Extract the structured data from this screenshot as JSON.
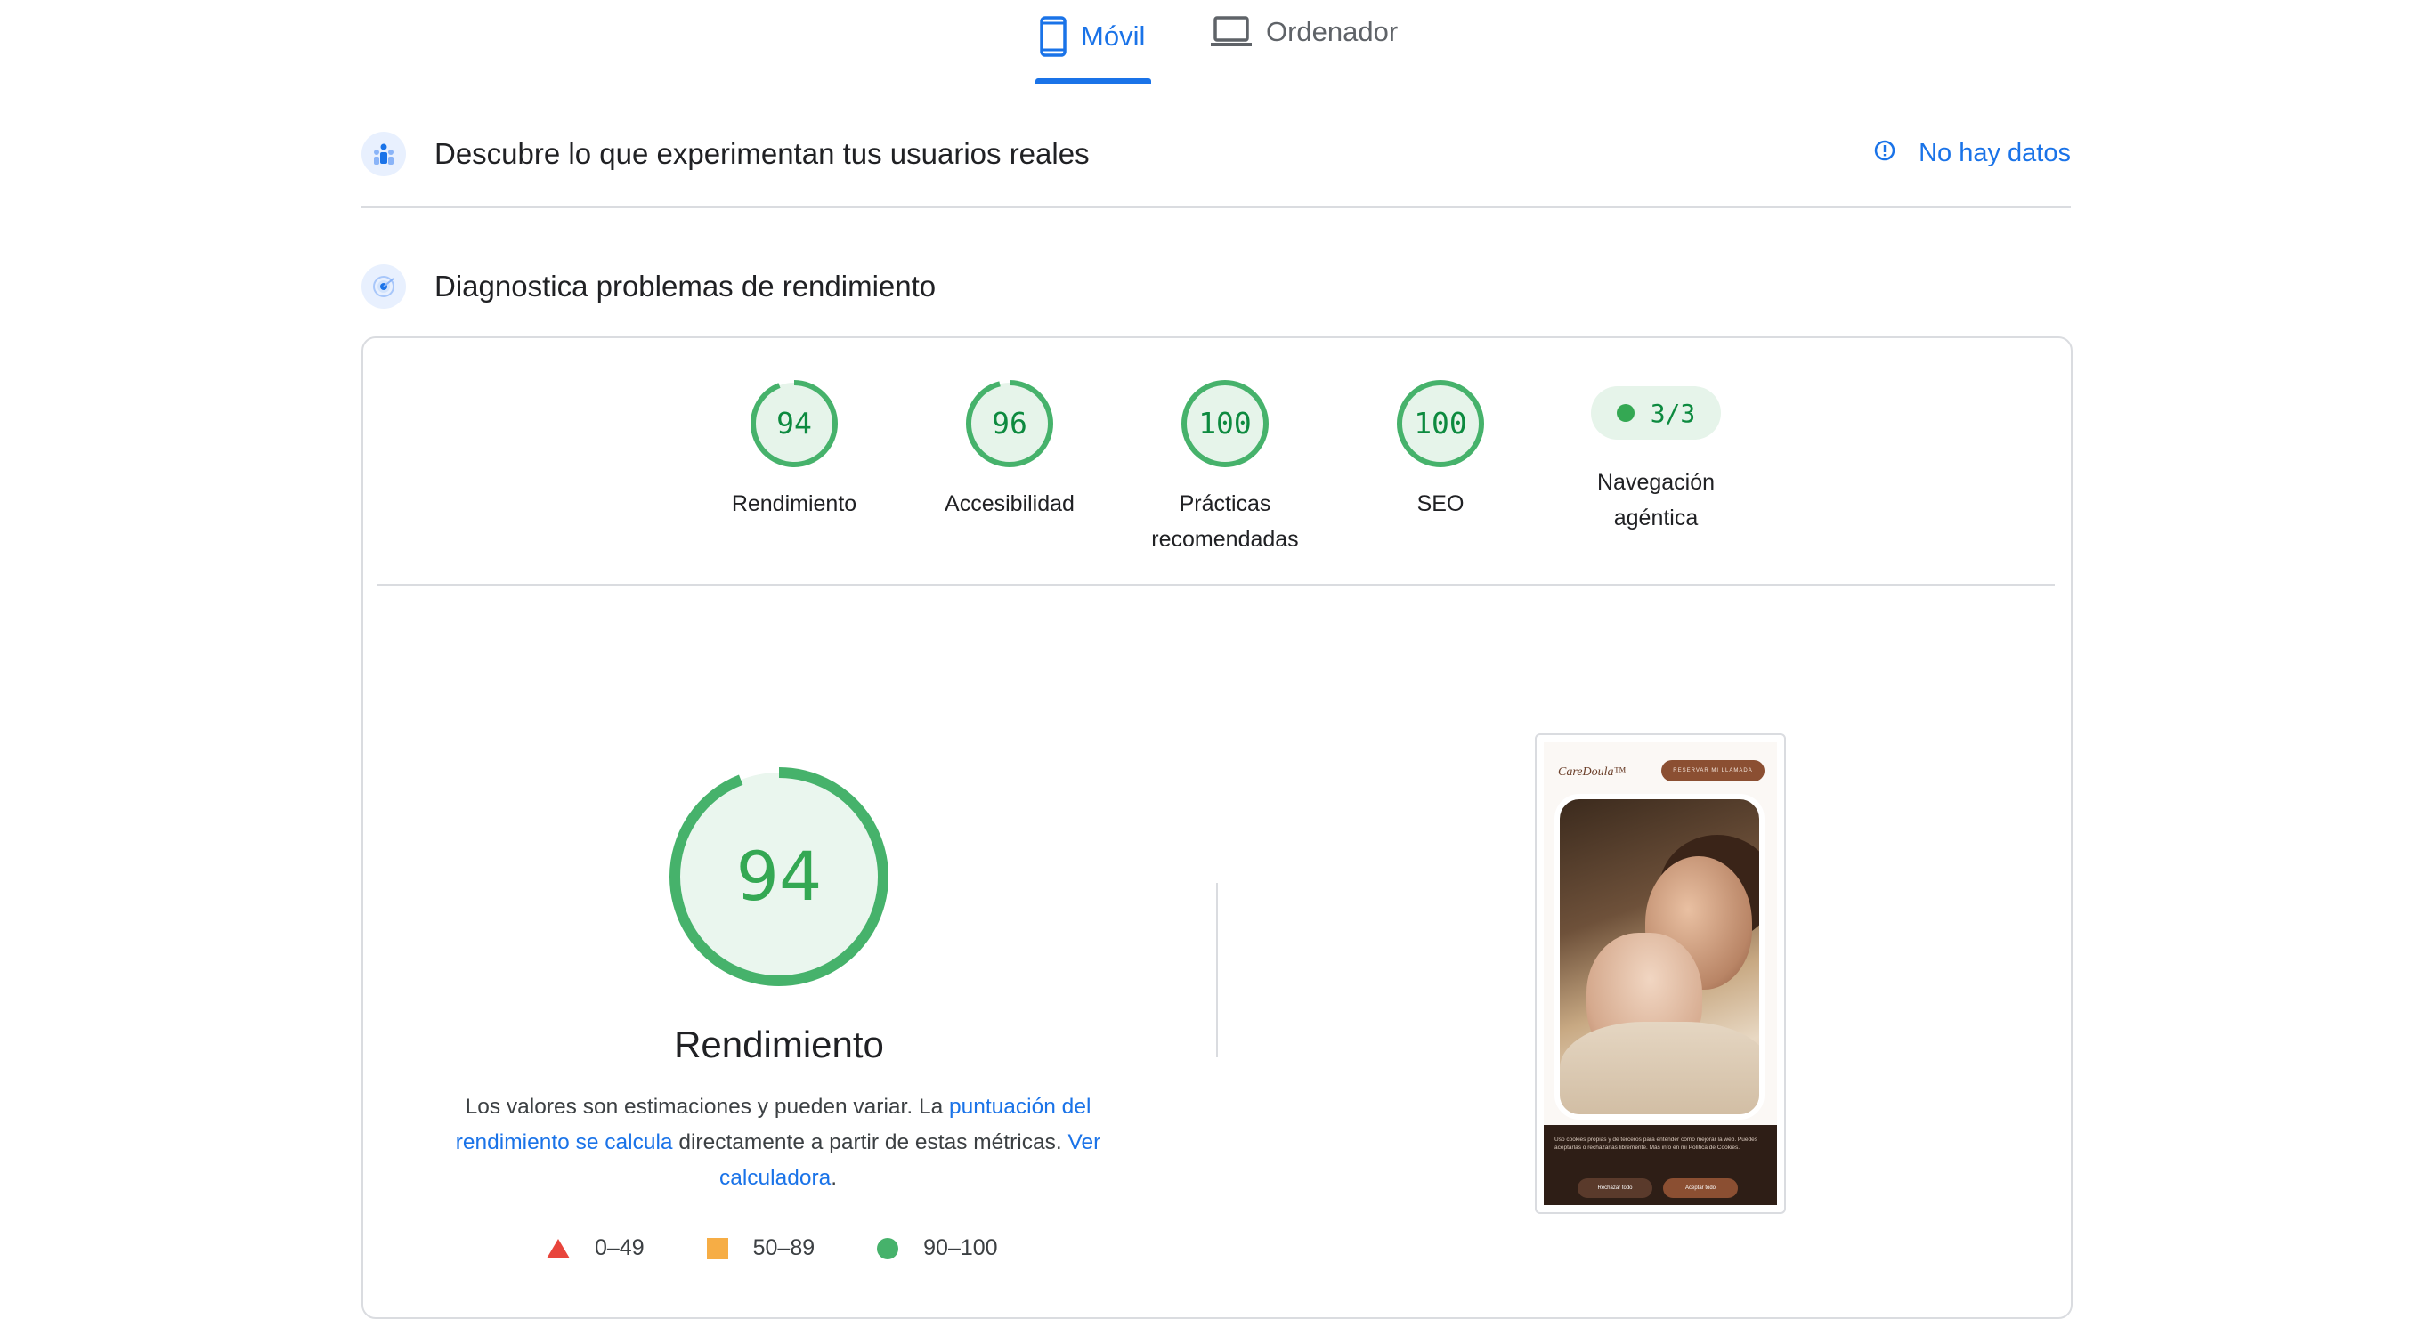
{
  "tabs": [
    {
      "label": "Móvil",
      "icon": "phone-icon",
      "active": true
    },
    {
      "label": "Ordenador",
      "icon": "laptop-icon",
      "active": false
    }
  ],
  "field_section": {
    "title": "Descubre lo que experimentan tus usuarios reales",
    "status": "No hay datos",
    "status_icon": "info-icon"
  },
  "lab_section": {
    "title": "Diagnostica problemas de rendimiento"
  },
  "categories": [
    {
      "score": "94",
      "label": "Rendimiento",
      "value": 94
    },
    {
      "score": "96",
      "label": "Accesibilidad",
      "value": 96
    },
    {
      "score": "100",
      "label": "Prácticas recomendadas",
      "value": 100
    },
    {
      "score": "100",
      "label": "SEO",
      "value": 100
    },
    {
      "score": "3/3",
      "label": "Navegación agéntica"
    }
  ],
  "performance": {
    "score": "94",
    "value": 94,
    "title": "Rendimiento",
    "desc_part1": "Los valores son estimaciones y pueden variar. La ",
    "desc_link1": "puntuación del rendimiento se calcula",
    "desc_part2": " directamente a partir de estas métricas. ",
    "desc_link2": "Ver calculadora",
    "desc_part3": "."
  },
  "legend": [
    {
      "range": "0–49",
      "color": "#e8453c"
    },
    {
      "range": "50–89",
      "color": "#f6ad45"
    },
    {
      "range": "90–100",
      "color": "#46b26b"
    }
  ],
  "screenshot": {
    "logo": "CareDoula™",
    "cta": "RESERVAR MI LLAMADA",
    "cookie_text": "Uso cookies propias y de terceros para entender cómo mejorar la web. Puedes aceptarlas o rechazarlas libremente. Más info en mi Política de Cookies.",
    "reject": "Rechazar todo",
    "accept": "Aceptar todo"
  },
  "colors": {
    "accent": "#1a73e8",
    "pass": "#34a853",
    "pass_text": "#0d8a3f"
  }
}
